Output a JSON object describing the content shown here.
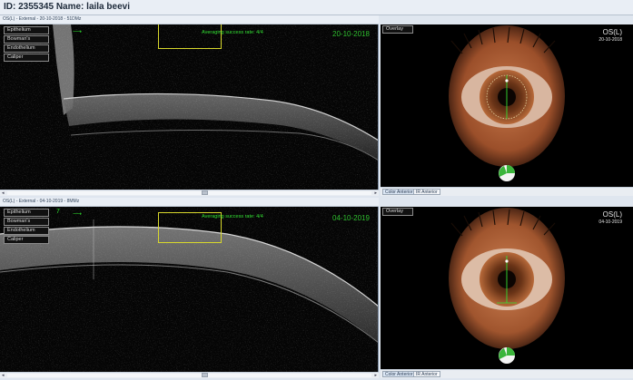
{
  "header": {
    "id_label": "ID: 2355345   Name:  laila beevi"
  },
  "layers": [
    "Epithelium",
    "Bowman's",
    "Endothelium",
    "Caliper"
  ],
  "overlay_label": "Overlay",
  "tabs": {
    "color": "Color Anterior",
    "ir": "IR Anterior"
  },
  "scans": [
    {
      "title": "OS(L) - External - 20-10-2018 - 51DMz",
      "success_text": "Averaging success rate: 4/4",
      "date": "20-10-2018",
      "eye_label": "OS(L)",
      "eye_date": "20-10-2018",
      "number": ""
    },
    {
      "title": "OS(L) - External - 04-10-2019 - 8MMz",
      "success_text": "Averaging success rate: 4/4",
      "date": "04-10-2019",
      "eye_label": "OS(L)",
      "eye_date": "04-10-2019",
      "number": "7"
    }
  ],
  "colors": {
    "accent_green": "#2fbf2f",
    "box_yellow": "#d8d82c",
    "iris": "#b05a2e"
  },
  "icons": [
    "right-arrow-icon",
    "left-arrow-icon",
    "pie-indicator-icon"
  ]
}
